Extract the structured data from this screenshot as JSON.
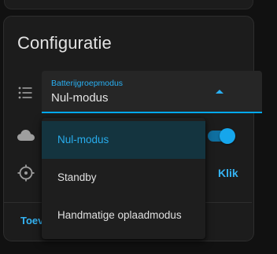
{
  "card": {
    "title": "Configuratie"
  },
  "select": {
    "label": "Batterijgroepmodus",
    "value": "Nul-modus"
  },
  "toggle": {
    "checked": true
  },
  "action": {
    "klik_label": "Klik"
  },
  "footer": {
    "toev_label": "Toev"
  },
  "menu": {
    "items": [
      {
        "label": "Nul-modus",
        "selected": true
      },
      {
        "label": "Standby",
        "selected": false
      },
      {
        "label": "Handmatige oplaadmodus",
        "selected": false
      }
    ]
  },
  "colors": {
    "accent": "#03a9f4",
    "background": "#111111",
    "card": "#1c1c1c",
    "selected_item_bg": "#14343f"
  },
  "icons": [
    "format-list-bulleted-icon",
    "cloud-icon",
    "target-icon",
    "menu-up-icon"
  ]
}
